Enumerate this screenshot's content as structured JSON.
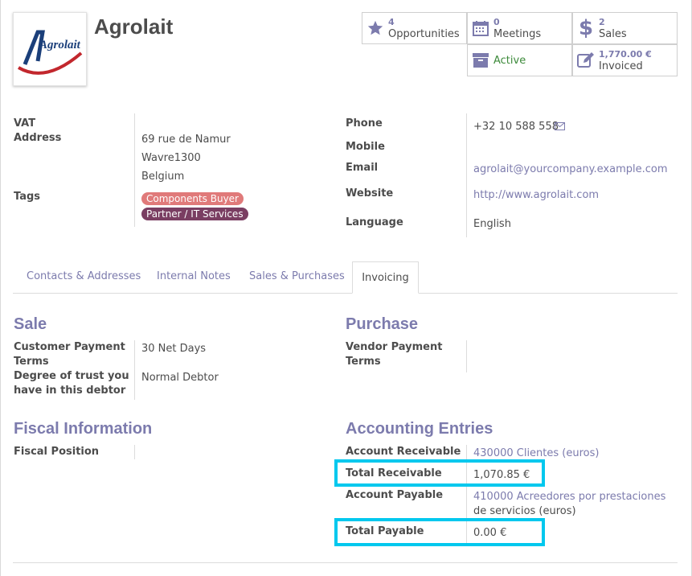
{
  "partner": {
    "name": "Agrolait",
    "logo_text": "Agrolait"
  },
  "stats": {
    "opportunities": {
      "count": "4",
      "label": "Opportunities"
    },
    "meetings": {
      "count": "0",
      "label": "Meetings"
    },
    "sales": {
      "count": "2",
      "label": "Sales"
    },
    "active": {
      "label": "Active"
    },
    "invoiced": {
      "amount": "1,770.00 €",
      "label": "Invoiced"
    }
  },
  "info_left": {
    "vat_label": "VAT",
    "address_label": "Address",
    "address_line1": "69 rue de Namur",
    "address_line2": "Wavre1300",
    "address_line3": "Belgium",
    "tags_label": "Tags",
    "tags": [
      {
        "label": "Components Buyer",
        "color": "#e07a7a"
      },
      {
        "label": "Partner / IT Services",
        "color": "#7a3e62"
      }
    ]
  },
  "info_right": {
    "phone_label": "Phone",
    "phone": "+32 10 588 558",
    "mobile_label": "Mobile",
    "email_label": "Email",
    "email": "agrolait@yourcompany.example.com",
    "website_label": "Website",
    "website": "http://www.agrolait.com",
    "language_label": "Language",
    "language": "English"
  },
  "tabs": [
    {
      "label": "Contacts & Addresses"
    },
    {
      "label": "Internal Notes"
    },
    {
      "label": "Sales & Purchases"
    },
    {
      "label": "Invoicing",
      "active": true
    }
  ],
  "sale": {
    "title": "Sale",
    "payment_terms_label_1": "Customer Payment",
    "payment_terms_label_2": "Terms",
    "payment_terms": "30 Net Days",
    "trust_label_1": "Degree of trust you",
    "trust_label_2": "have in this debtor",
    "trust": "Normal Debtor"
  },
  "purchase": {
    "title": "Purchase",
    "vendor_terms_label_1": "Vendor Payment",
    "vendor_terms_label_2": "Terms"
  },
  "fiscal": {
    "title": "Fiscal Information",
    "position_label": "Fiscal Position"
  },
  "accounting": {
    "title": "Accounting Entries",
    "receivable_label": "Account Receivable",
    "receivable": "430000 Clientes (euros)",
    "total_receivable_label": "Total Receivable",
    "total_receivable": "1,070.85 €",
    "payable_label": "Account Payable",
    "payable_line1": "410000 Acreedores por prestaciones",
    "payable_line2": "de servicios (euros)",
    "total_payable_label": "Total Payable",
    "total_payable": "0.00 €"
  },
  "colors": {
    "accent": "#7c7bad",
    "highlight": "#00c8ee",
    "active_green": "#3c8a3a"
  },
  "icons": [
    "star-icon",
    "calendar-icon",
    "dollar-icon",
    "archive-icon",
    "edit-icon",
    "envelope-icon"
  ]
}
